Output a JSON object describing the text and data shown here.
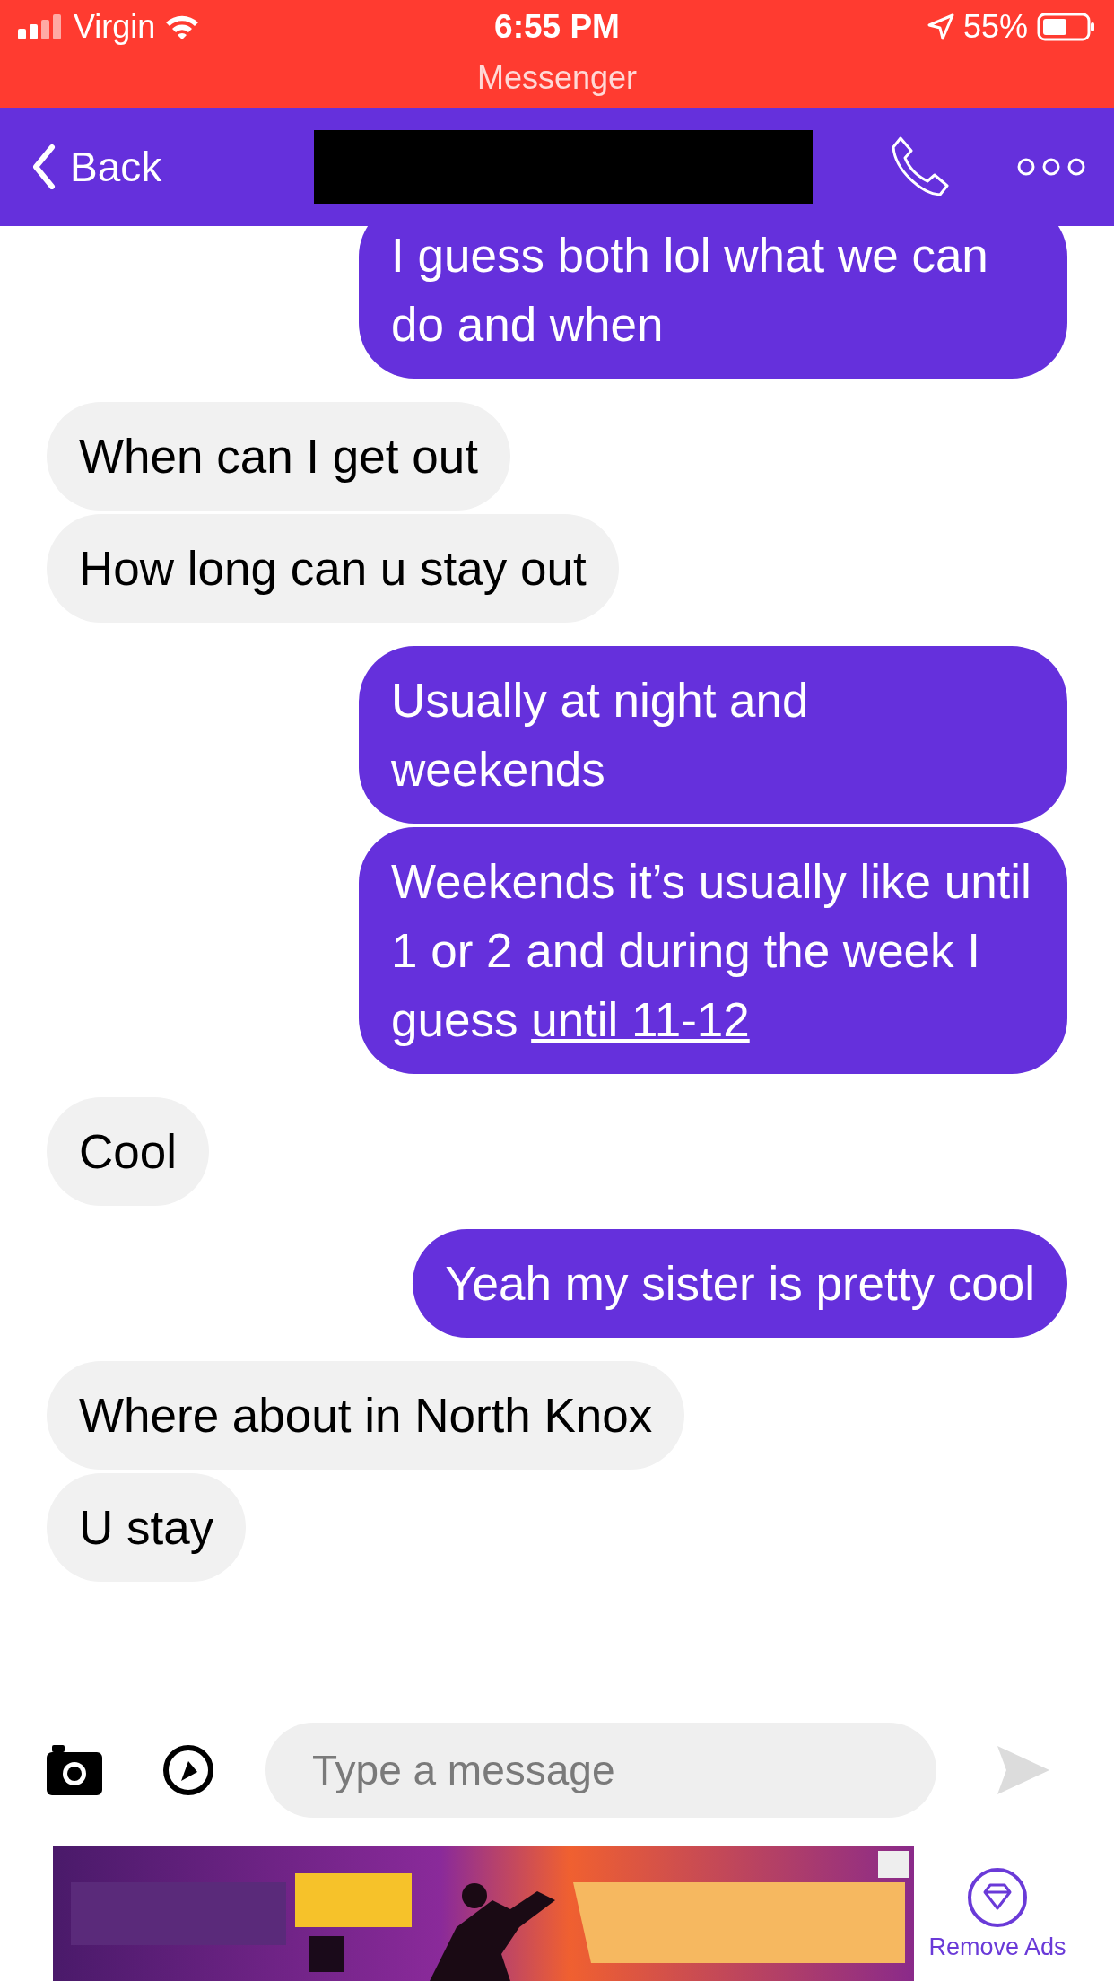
{
  "status_bar": {
    "carrier": "Virgin",
    "time": "6:55 PM",
    "battery": "55%",
    "return_app": "Messenger"
  },
  "header": {
    "back": "Back"
  },
  "messages": [
    {
      "kind": "sent",
      "text": "I guess both lol what we can do and when"
    },
    {
      "kind": "received",
      "text": "When can I get out"
    },
    {
      "kind": "received",
      "text": "How long can u stay out"
    },
    {
      "kind": "sent",
      "text": "Usually at night and weekends"
    },
    {
      "kind": "sent",
      "text": "Weekends it’s usually like until 1 or 2 and during the week I guess ",
      "link": "until 11-12"
    },
    {
      "kind": "received",
      "text": "Cool"
    },
    {
      "kind": "sent",
      "text": "Yeah my sister is pretty cool"
    },
    {
      "kind": "received",
      "text": "Where about in North Knox"
    },
    {
      "kind": "received",
      "text": "U stay"
    }
  ],
  "composer": {
    "placeholder": "Type a message"
  },
  "ad": {
    "kind": "picture",
    "remove_label": "Remove Ads"
  }
}
